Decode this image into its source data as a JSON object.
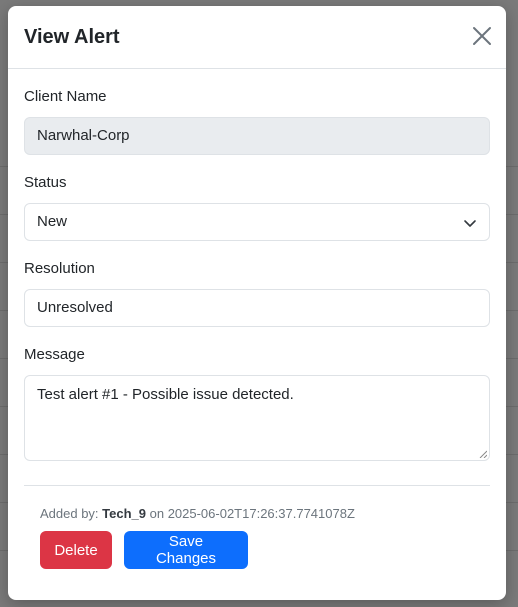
{
  "modal": {
    "title": "View Alert"
  },
  "form": {
    "client_name_label": "Client Name",
    "client_name_value": "Narwhal-Corp",
    "status_label": "Status",
    "status_value": "New",
    "resolution_label": "Resolution",
    "resolution_value": "Unresolved",
    "message_label": "Message",
    "message_value": "Test alert #1 - Possible issue detected."
  },
  "footer": {
    "added_by_prefix": "Added by: ",
    "added_by_user": "Tech_9",
    "on_text": " on ",
    "timestamp": "2025-06-02T17:26:37.7741078Z",
    "delete_label": "Delete",
    "save_label": "Save Changes"
  },
  "icons": {
    "close": "close-icon",
    "chevron": "chevron-down-icon"
  },
  "colors": {
    "danger": "#dc3545",
    "primary": "#0d6efd",
    "readonly_bg": "#e9ecef",
    "border": "#dee2e6"
  }
}
